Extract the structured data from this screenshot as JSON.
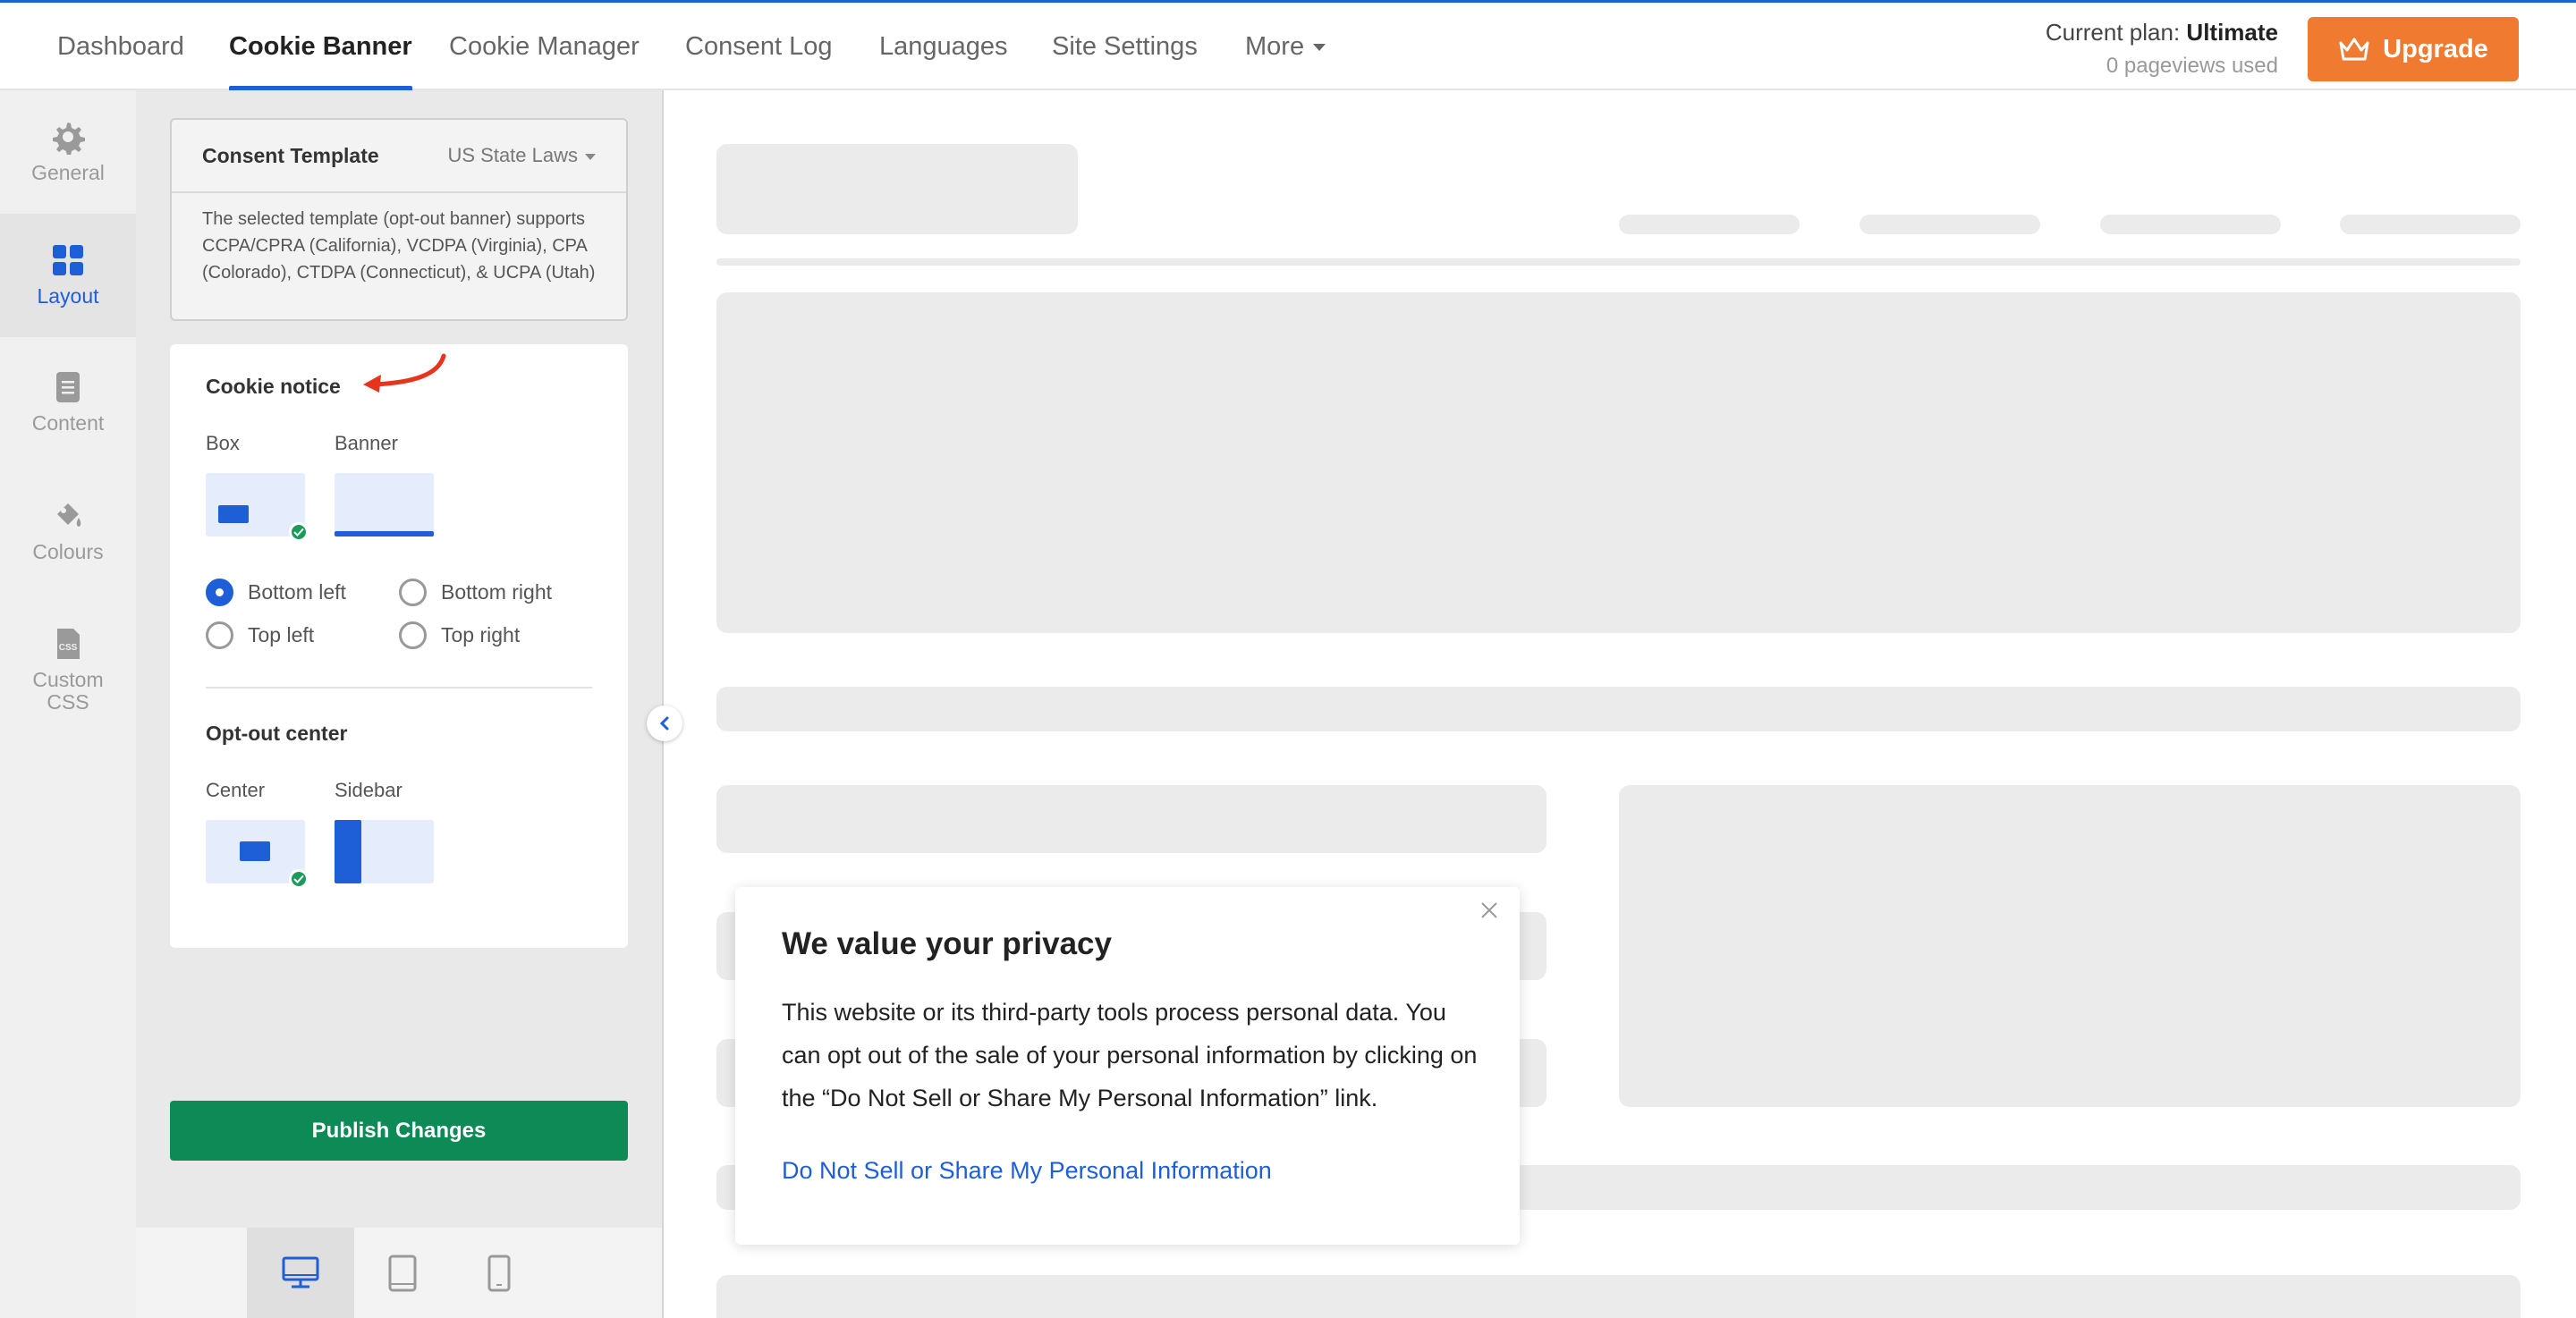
{
  "nav": {
    "tabs": [
      {
        "label": "Dashboard"
      },
      {
        "label": "Cookie Banner"
      },
      {
        "label": "Cookie Manager"
      },
      {
        "label": "Consent Log"
      },
      {
        "label": "Languages"
      },
      {
        "label": "Site Settings"
      },
      {
        "label": "More"
      }
    ],
    "active_tab": "Cookie Banner",
    "plan_prefix": "Current plan:",
    "plan_name": "Ultimate",
    "pageviews": "0 pageviews used",
    "upgrade_label": "Upgrade",
    "upgrade_icon": "crown-icon"
  },
  "rail": {
    "items": [
      {
        "label": "General",
        "icon": "gear-icon"
      },
      {
        "label": "Layout",
        "icon": "grid-icon"
      },
      {
        "label": "Content",
        "icon": "document-icon"
      },
      {
        "label": "Colours",
        "icon": "paint-bucket-icon"
      },
      {
        "label": "Custom CSS",
        "icon": "css-file-icon"
      }
    ],
    "active": "Layout"
  },
  "template": {
    "title": "Consent Template",
    "selected": "US State Laws",
    "description": "The selected template (opt-out banner) supports CCPA/CPRA (California), VCDPA (Virginia), CPA (Colorado), CTDPA (Connecticut), & UCPA (Utah)"
  },
  "cookie_notice": {
    "title": "Cookie notice",
    "options": [
      {
        "label": "Box",
        "selected": true
      },
      {
        "label": "Banner",
        "selected": false
      }
    ],
    "positions": [
      {
        "label": "Bottom left",
        "selected": true
      },
      {
        "label": "Bottom right",
        "selected": false
      },
      {
        "label": "Top left",
        "selected": false
      },
      {
        "label": "Top right",
        "selected": false
      }
    ]
  },
  "opt_out_center": {
    "title": "Opt-out center",
    "options": [
      {
        "label": "Center",
        "selected": true
      },
      {
        "label": "Sidebar",
        "selected": false
      }
    ]
  },
  "publish_label": "Publish Changes",
  "devices": [
    {
      "icon": "desktop-icon",
      "active": true
    },
    {
      "icon": "tablet-icon",
      "active": false
    },
    {
      "icon": "mobile-icon",
      "active": false
    }
  ],
  "preview": {
    "cookie_title": "We value your privacy",
    "cookie_text": "This website or its third-party tools process personal data. You can opt out of the sale of your personal information by clicking on the “Do Not Sell or Share My Personal Information” link.",
    "cookie_link": "Do Not Sell or Share My Personal Information"
  },
  "colors": {
    "accent": "#1e5fd8",
    "upgrade": "#ef7a30",
    "publish": "#0e8a56",
    "annotation_arrow": "#e8341c"
  }
}
